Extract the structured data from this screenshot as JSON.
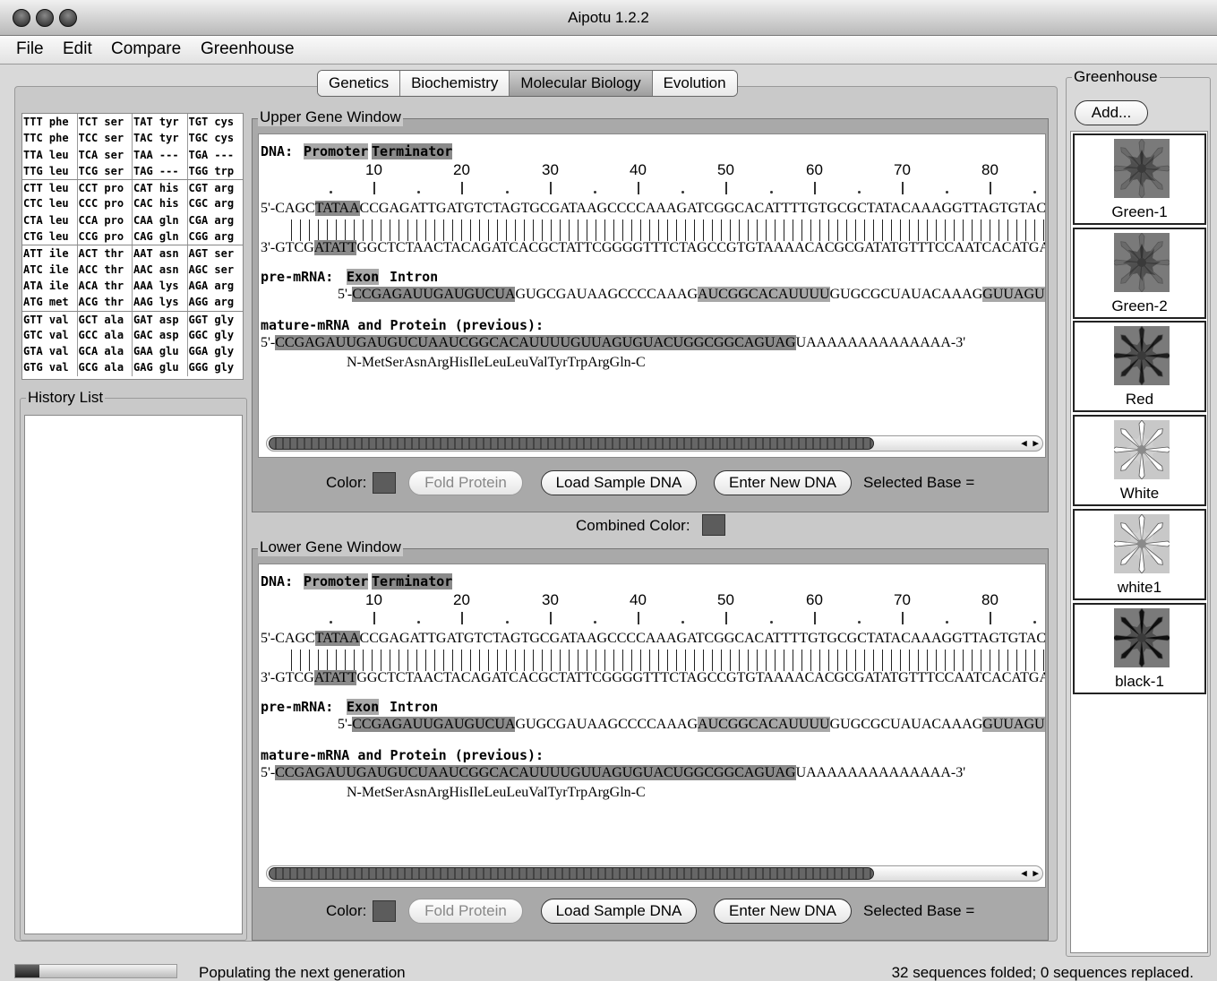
{
  "window": {
    "title": "Aipotu 1.2.2"
  },
  "menu": [
    "File",
    "Edit",
    "Compare",
    "Greenhouse"
  ],
  "tabs": [
    {
      "label": "Genetics"
    },
    {
      "label": "Biochemistry"
    },
    {
      "label": "Molecular Biology"
    },
    {
      "label": "Evolution"
    }
  ],
  "codon_table": [
    [
      "TTT phe",
      "TCT ser",
      "TAT tyr",
      "TGT cys"
    ],
    [
      "TTC phe",
      "TCC ser",
      "TAC tyr",
      "TGC cys"
    ],
    [
      "TTA leu",
      "TCA ser",
      "TAA ---",
      "TGA ---"
    ],
    [
      "TTG leu",
      "TCG ser",
      "TAG ---",
      "TGG trp"
    ],
    [
      "CTT leu",
      "CCT pro",
      "CAT his",
      "CGT arg"
    ],
    [
      "CTC leu",
      "CCC pro",
      "CAC his",
      "CGC arg"
    ],
    [
      "CTA leu",
      "CCA pro",
      "CAA gln",
      "CGA arg"
    ],
    [
      "CTG leu",
      "CCG pro",
      "CAG gln",
      "CGG arg"
    ],
    [
      "ATT ile",
      "ACT thr",
      "AAT asn",
      "AGT ser"
    ],
    [
      "ATC ile",
      "ACC thr",
      "AAC asn",
      "AGC ser"
    ],
    [
      "ATA ile",
      "ACA thr",
      "AAA lys",
      "AGA arg"
    ],
    [
      "ATG met",
      "ACG thr",
      "AAG lys",
      "AGG arg"
    ],
    [
      "GTT val",
      "GCT ala",
      "GAT asp",
      "GGT gly"
    ],
    [
      "GTC val",
      "GCC ala",
      "GAC asp",
      "GGC gly"
    ],
    [
      "GTA val",
      "GCA ala",
      "GAA glu",
      "GGA gly"
    ],
    [
      "GTG val",
      "GCG ala",
      "GAG glu",
      "GGG gly"
    ]
  ],
  "history": {
    "label": "History List"
  },
  "gene": {
    "dna_label": "DNA:",
    "promoter": "Promoter",
    "terminator": "Terminator",
    "ruler": [
      "10",
      "20",
      "30",
      "40",
      "50",
      "60",
      "70",
      "80"
    ],
    "top_prefix": "5'-CAGC",
    "top_box": "TATAA",
    "top_rest": "CCGAGATTGATGTCTAGTGCGATAAGCCCCAAAGATCGGCACATTTTGTGCGCTATACAAAGGTTAGTGTACTGGCG",
    "bottom_prefix": "3'-GTCG",
    "bottom_box": "ATATT",
    "bottom_rest": "GGCTCTAACTACAGATCACGCTATTCGGGGTTTCTAGCCGTGTAAAACACGCGATATGTTTCCAATCACATGACCGC",
    "premrna_label": "pre-mRNA:",
    "exon": "Exon",
    "intron": "Intron",
    "pre_prefix": "5'-",
    "pre_exon1": "CCGAGAUUGAUGUCUA",
    "pre_intron": "GUGCGAUAAGCCCCAAAG",
    "pre_exon2": "AUCGGCACAUUUU",
    "pre_rest1": "GUGCGCUAUACAAAG",
    "pre_exon3": "GUUAGUGUACUGGCG",
    "mature_label": "mature-mRNA and Protein (previous):",
    "mature_prefix": "5'-",
    "mature_hl": "CCGAGAUUGAUGUCUAAUCGGCACAUUUUGUUAGUGUACUGGCGGCAGUAG",
    "mature_rest": "UAAAAAAAAAAAAAA-3'",
    "protein": "N-MetSerAsnArgHisIleLeuLeuValTyrTrpArgGln-C",
    "color_label": "Color:",
    "fold_button": "Fold Protein",
    "load_button": "Load Sample DNA",
    "enter_button": "Enter New DNA",
    "selected_base": "Selected Base ="
  },
  "upper_window": {
    "label": "Upper Gene Window"
  },
  "lower_window": {
    "label": "Lower Gene Window"
  },
  "combined": {
    "label": "Combined Color:"
  },
  "greenhouse": {
    "label": "Greenhouse",
    "add_button": "Add...",
    "items": [
      {
        "name": "Green-1",
        "color": "#6a6a6a",
        "center": "#3a3a3a"
      },
      {
        "name": "Green-2",
        "color": "#6a6a6a",
        "center": "#3a3a3a"
      },
      {
        "name": "Red",
        "color": "#1e1e1e",
        "center": "#3a3a3a"
      },
      {
        "name": "White",
        "color": "#ffffff",
        "center": "#8a8a8a"
      },
      {
        "name": "white1",
        "color": "#ffffff",
        "center": "#8a8a8a"
      },
      {
        "name": "black-1",
        "color": "#101010",
        "center": "#3a3a3a"
      }
    ]
  },
  "status": {
    "progress": 0.15,
    "left_text": "Populating the next generation",
    "right_text": "32 sequences folded; 0 sequences replaced."
  }
}
